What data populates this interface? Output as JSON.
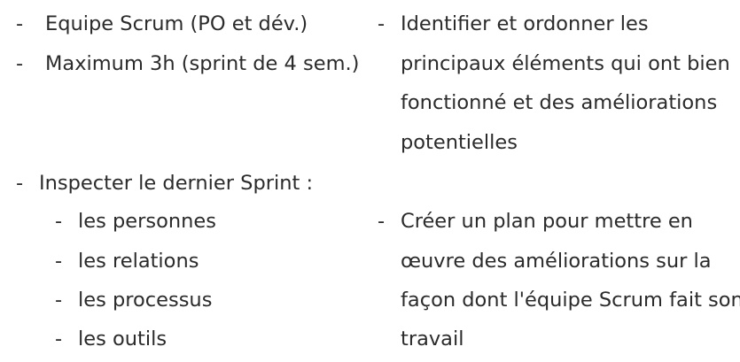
{
  "bullet": "-",
  "left_column": {
    "top_items": [
      "Equipe Scrum (PO et dév.)",
      "Maximum 3h (sprint de 4 sem.)"
    ],
    "inspect": {
      "label": "Inspecter le dernier Sprint :",
      "sub_items": [
        "les personnes",
        "les relations",
        "les processus",
        "les outils"
      ]
    }
  },
  "right_column": {
    "item1_lines": [
      "Identifier et ordonner les",
      "principaux éléments qui ont bien",
      "fonctionné et des améliorations",
      "potentielles"
    ],
    "item2_lines": [
      "Créer un plan pour mettre en",
      "œuvre des améliorations sur la",
      "façon dont l'équipe Scrum fait son",
      "travail"
    ]
  }
}
